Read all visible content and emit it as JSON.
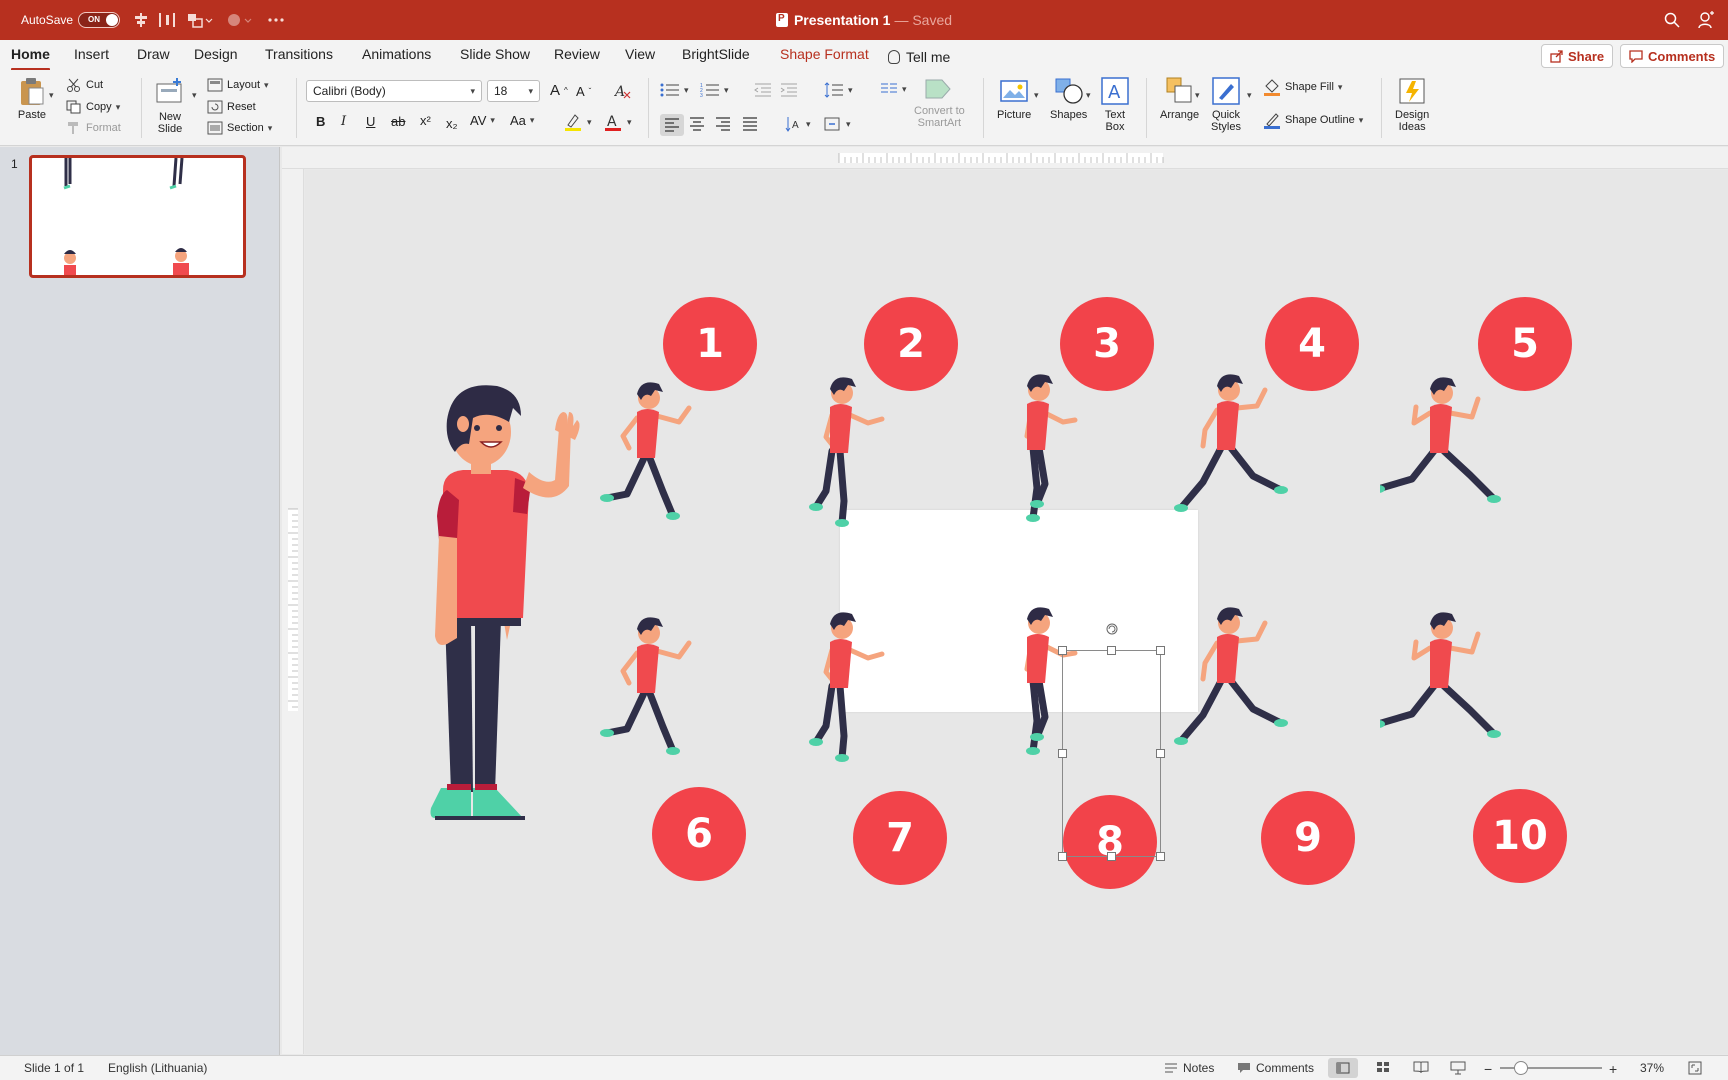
{
  "titlebar": {
    "autosave_label": "AutoSave",
    "autosave_state": "ON",
    "doc_title": "Presentation 1",
    "doc_status": "— Saved"
  },
  "tabs": [
    {
      "label": "Home",
      "active": true
    },
    {
      "label": "Insert"
    },
    {
      "label": "Draw"
    },
    {
      "label": "Design"
    },
    {
      "label": "Transitions"
    },
    {
      "label": "Animations"
    },
    {
      "label": "Slide Show"
    },
    {
      "label": "Review"
    },
    {
      "label": "View"
    },
    {
      "label": "BrightSlide"
    },
    {
      "label": "Shape Format"
    }
  ],
  "tell_me": "Tell me",
  "share_label": "Share",
  "comments_label": "Comments",
  "ribbon": {
    "paste": "Paste",
    "cut": "Cut",
    "copy": "Copy",
    "format": "Format",
    "new_slide_1": "New",
    "new_slide_2": "Slide",
    "layout": "Layout",
    "reset": "Reset",
    "section": "Section",
    "font_name": "Calibri (Body)",
    "font_size": "18",
    "bold": "B",
    "italic": "I",
    "underline": "U",
    "strike": "ab",
    "superscript": "x²",
    "subscript": "x₂",
    "char_spacing": "AV",
    "change_case": "Aa",
    "grow_font": "A",
    "shrink_font": "A",
    "convert_smartart_1": "Convert to",
    "convert_smartart_2": "SmartArt",
    "picture": "Picture",
    "shapes": "Shapes",
    "text_box_1": "Text",
    "text_box_2": "Box",
    "arrange": "Arrange",
    "quick_styles_1": "Quick",
    "quick_styles_2": "Styles",
    "shape_fill": "Shape Fill",
    "shape_outline": "Shape Outline",
    "design_ideas_1": "Design",
    "design_ideas_2": "Ideas"
  },
  "thumbnails": {
    "slide_number": "1"
  },
  "slide": {
    "numbers_top": [
      "1",
      "2",
      "3",
      "4",
      "5"
    ],
    "numbers_bottom": [
      "6",
      "7",
      "8",
      "9",
      "10"
    ]
  },
  "status": {
    "slide_of": "Slide 1 of 1",
    "language": "English (Lithuania)",
    "notes": "Notes",
    "comments": "Comments",
    "zoom": "37%"
  },
  "colors": {
    "accent": "#b7301f",
    "circle": "#f2434a",
    "shirt": "#f04a4e",
    "pants": "#2f2f48",
    "shoes": "#4fd1a7",
    "skin": "#f5a47e",
    "hair": "#2e2b45"
  }
}
